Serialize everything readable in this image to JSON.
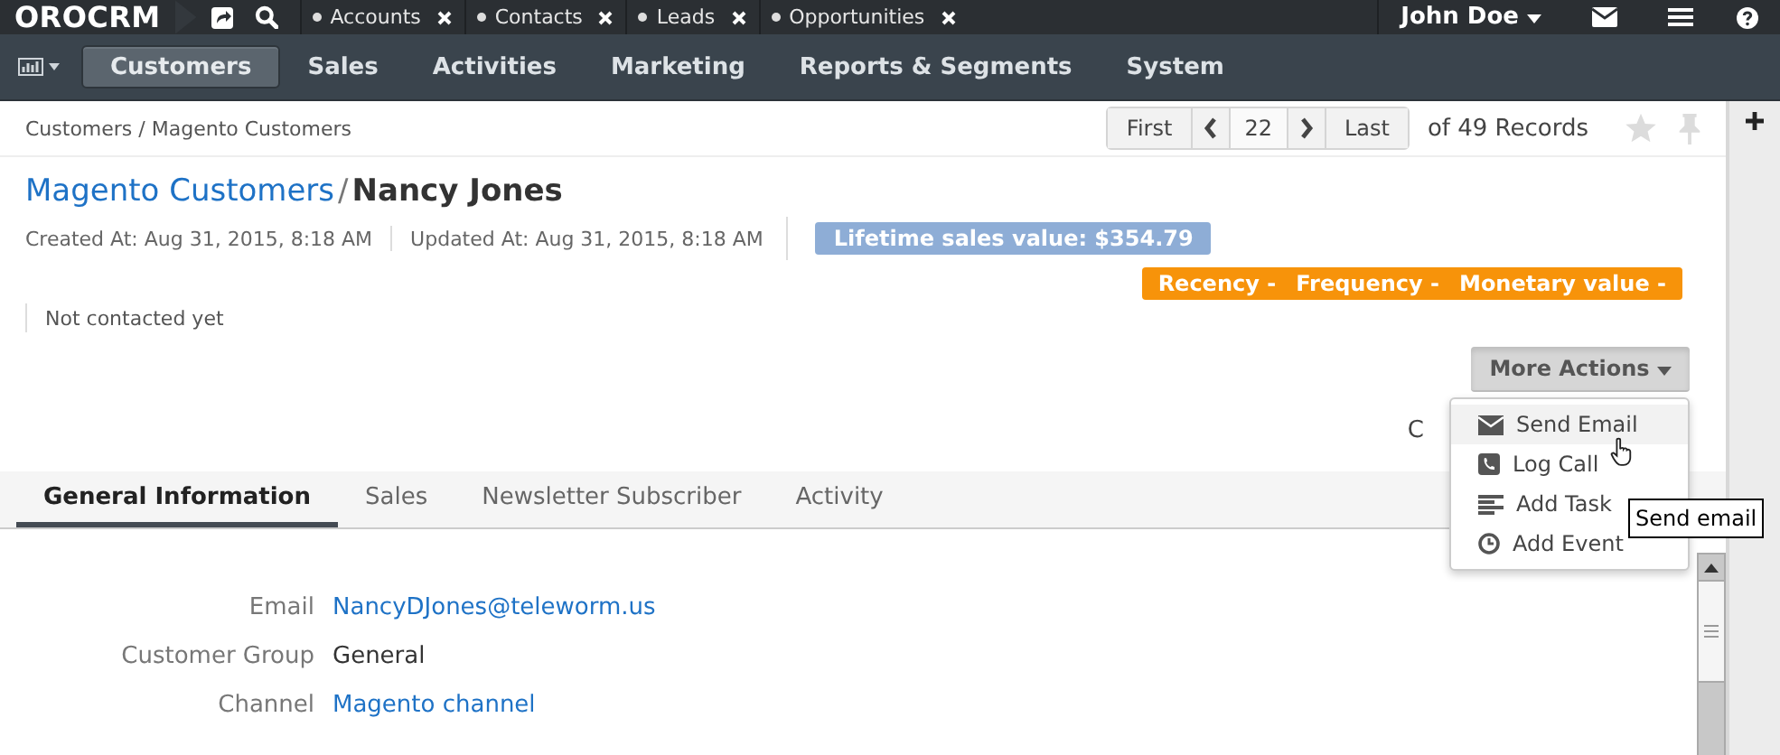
{
  "logo": "OROCRM",
  "top_tabs": [
    {
      "label": "Accounts"
    },
    {
      "label": "Contacts"
    },
    {
      "label": "Leads"
    },
    {
      "label": "Opportunities"
    }
  ],
  "user": {
    "name": "John Doe"
  },
  "menu": [
    {
      "label": "Customers",
      "selected": true
    },
    {
      "label": "Sales",
      "selected": false
    },
    {
      "label": "Activities",
      "selected": false
    },
    {
      "label": "Marketing",
      "selected": false
    },
    {
      "label": "Reports & Segments",
      "selected": false
    },
    {
      "label": "System",
      "selected": false
    }
  ],
  "breadcrumb": "Customers / Magento Customers",
  "pager": {
    "first": "First",
    "current": "22",
    "last": "Last",
    "total": "of 49 Records"
  },
  "title": {
    "parent": "Magento Customers",
    "separator": "/",
    "name": "Nancy Jones"
  },
  "meta": [
    "Created At: Aug 31, 2015, 8:18 AM",
    "Updated At: Aug 31, 2015, 8:18 AM"
  ],
  "lifetime_badge": "Lifetime sales value: $354.79",
  "rfm": [
    "Recency -",
    "Frequency -",
    "Monetary value -"
  ],
  "contact_status": "Not contacted yet",
  "more_actions": {
    "label": "More Actions",
    "expanded": true,
    "items": [
      {
        "label": "Send Email",
        "kind": "email",
        "selected": true
      },
      {
        "label": "Log Call",
        "kind": "call",
        "selected": false
      },
      {
        "label": "Add Task",
        "kind": "task",
        "selected": false
      },
      {
        "label": "Add Event",
        "kind": "event",
        "selected": false
      }
    ]
  },
  "covered_text": "C",
  "tooltip": "Send email",
  "tabs": [
    {
      "label": "General Information",
      "selected": true
    },
    {
      "label": "Sales",
      "selected": false
    },
    {
      "label": "Newsletter Subscriber",
      "selected": false
    },
    {
      "label": "Activity",
      "selected": false
    }
  ],
  "fields": [
    {
      "label": "Email",
      "value": "NancyDJones@teleworm.us",
      "kind": "link"
    },
    {
      "label": "Customer Group",
      "value": "General",
      "kind": "text"
    },
    {
      "label": "Channel",
      "value": "Magento channel",
      "kind": "link"
    }
  ]
}
